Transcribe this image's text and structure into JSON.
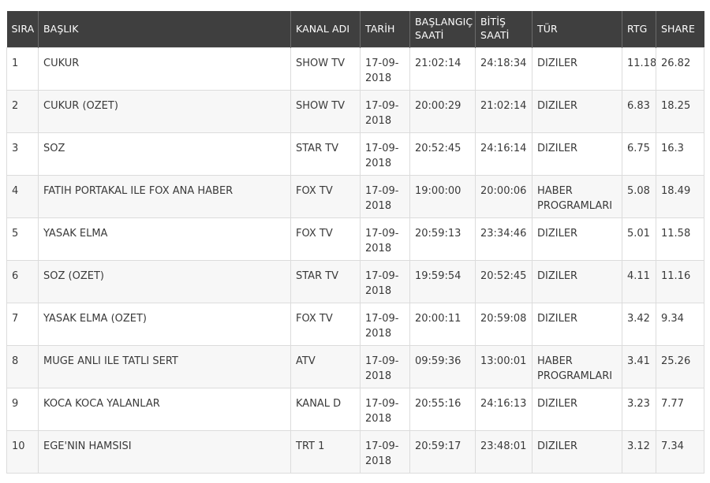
{
  "table": {
    "headers": {
      "sira": "SIRA",
      "baslik": "BAŞLIK",
      "kanal": "KANAL ADI",
      "tarih": "TARİH",
      "baslangic_line1": "BAŞLANGIÇ",
      "baslangic_line2": "SAATİ",
      "bitis_line1": "BİTİŞ",
      "bitis_line2": "SAATİ",
      "tur": "TÜR",
      "rtg": "RTG",
      "share": "SHARE"
    },
    "rows": [
      {
        "sira": "1",
        "baslik": "CUKUR",
        "kanal": "SHOW TV",
        "tarih_1": "17-09-",
        "tarih_2": "2018",
        "baslangic": "21:02:14",
        "bitis": "24:18:34",
        "tur_1": "DIZILER",
        "tur_2": "",
        "rtg": "11.18",
        "share": "26.82"
      },
      {
        "sira": "2",
        "baslik": "CUKUR (OZET)",
        "kanal": "SHOW TV",
        "tarih_1": "17-09-",
        "tarih_2": "2018",
        "baslangic": "20:00:29",
        "bitis": "21:02:14",
        "tur_1": "DIZILER",
        "tur_2": "",
        "rtg": "6.83",
        "share": "18.25"
      },
      {
        "sira": "3",
        "baslik": "SOZ",
        "kanal": "STAR TV",
        "tarih_1": "17-09-",
        "tarih_2": "2018",
        "baslangic": "20:52:45",
        "bitis": "24:16:14",
        "tur_1": "DIZILER",
        "tur_2": "",
        "rtg": "6.75",
        "share": "16.3"
      },
      {
        "sira": "4",
        "baslik": "FATIH PORTAKAL ILE FOX ANA HABER",
        "kanal": "FOX TV",
        "tarih_1": "17-09-",
        "tarih_2": "2018",
        "baslangic": "19:00:00",
        "bitis": "20:00:06",
        "tur_1": "HABER",
        "tur_2": "PROGRAMLARI",
        "rtg": "5.08",
        "share": "18.49"
      },
      {
        "sira": "5",
        "baslik": "YASAK ELMA",
        "kanal": "FOX TV",
        "tarih_1": "17-09-",
        "tarih_2": "2018",
        "baslangic": "20:59:13",
        "bitis": "23:34:46",
        "tur_1": "DIZILER",
        "tur_2": "",
        "rtg": "5.01",
        "share": "11.58"
      },
      {
        "sira": "6",
        "baslik": "SOZ (OZET)",
        "kanal": "STAR TV",
        "tarih_1": "17-09-",
        "tarih_2": "2018",
        "baslangic": "19:59:54",
        "bitis": "20:52:45",
        "tur_1": "DIZILER",
        "tur_2": "",
        "rtg": "4.11",
        "share": "11.16"
      },
      {
        "sira": "7",
        "baslik": "YASAK ELMA (OZET)",
        "kanal": "FOX TV",
        "tarih_1": "17-09-",
        "tarih_2": "2018",
        "baslangic": "20:00:11",
        "bitis": "20:59:08",
        "tur_1": "DIZILER",
        "tur_2": "",
        "rtg": "3.42",
        "share": "9.34"
      },
      {
        "sira": "8",
        "baslik": "MUGE ANLI ILE TATLI SERT",
        "kanal": "ATV",
        "tarih_1": "17-09-",
        "tarih_2": "2018",
        "baslangic": "09:59:36",
        "bitis": "13:00:01",
        "tur_1": "HABER",
        "tur_2": "PROGRAMLARI",
        "rtg": "3.41",
        "share": "25.26"
      },
      {
        "sira": "9",
        "baslik": "KOCA KOCA YALANLAR",
        "kanal": "KANAL D",
        "tarih_1": "17-09-",
        "tarih_2": "2018",
        "baslangic": "20:55:16",
        "bitis": "24:16:13",
        "tur_1": "DIZILER",
        "tur_2": "",
        "rtg": "3.23",
        "share": "7.77"
      },
      {
        "sira": "10",
        "baslik": "EGE'NIN HAMSISI",
        "kanal": "TRT 1",
        "tarih_1": "17-09-",
        "tarih_2": "2018",
        "baslangic": "20:59:17",
        "bitis": "23:48:01",
        "tur_1": "DIZILER",
        "tur_2": "",
        "rtg": "3.12",
        "share": "7.34"
      }
    ]
  },
  "colors": {
    "header_bg": "#3f3f3f",
    "header_text": "#ffffff",
    "row_alt_bg": "#f7f7f7",
    "border": "#dcdcdc"
  }
}
